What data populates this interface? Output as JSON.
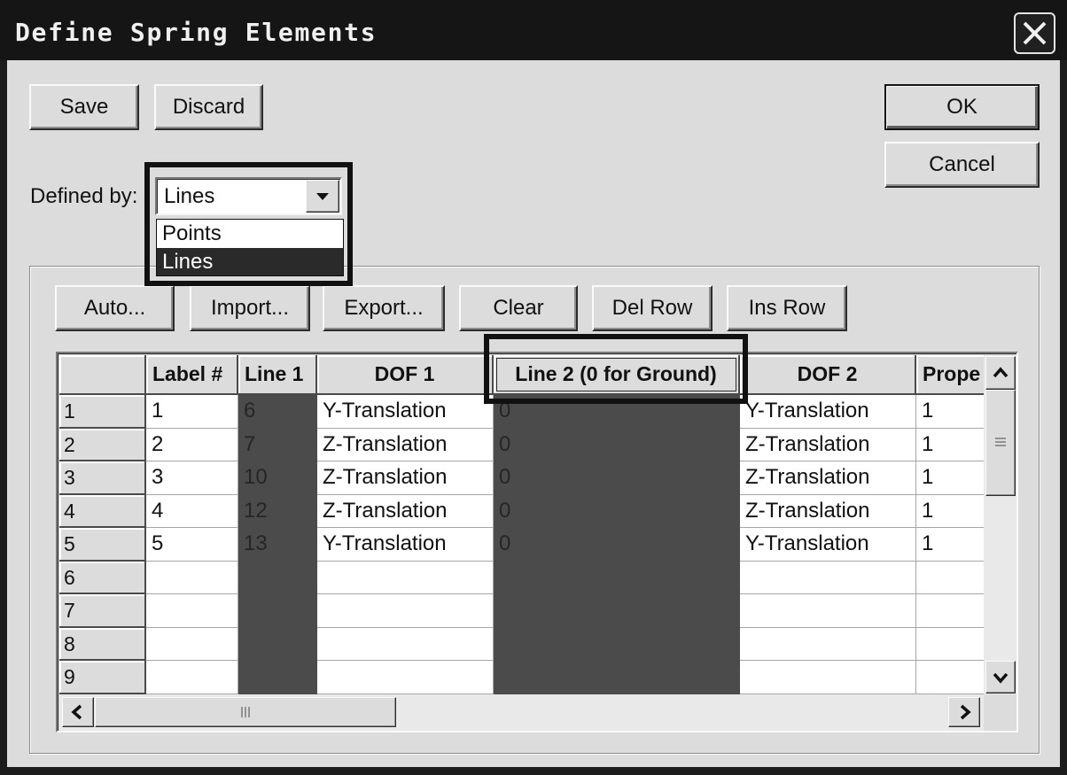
{
  "window": {
    "title": "Define Spring Elements"
  },
  "buttons": {
    "save": "Save",
    "discard": "Discard",
    "ok": "OK",
    "cancel": "Cancel"
  },
  "defined_by": {
    "label": "Defined by:",
    "value": "Lines",
    "expanded": true,
    "options": [
      "Points",
      "Lines"
    ],
    "highlighted_index": 1
  },
  "grid_buttons": {
    "auto": "Auto...",
    "import": "Import...",
    "export": "Export...",
    "clear": "Clear",
    "del_row": "Del Row",
    "ins_row": "Ins Row"
  },
  "table": {
    "columns": [
      "Label #",
      "Line 1",
      "DOF 1",
      "Line 2 (0 for Ground)",
      "DOF 2",
      "Prope"
    ],
    "rows": [
      {
        "num": "1",
        "cells": [
          "1",
          "6",
          "Y-Translation",
          "0",
          "Y-Translation",
          "1"
        ]
      },
      {
        "num": "2",
        "cells": [
          "2",
          "7",
          "Z-Translation",
          "0",
          "Z-Translation",
          "1"
        ]
      },
      {
        "num": "3",
        "cells": [
          "3",
          "10",
          "Z-Translation",
          "0",
          "Z-Translation",
          "1"
        ]
      },
      {
        "num": "4",
        "cells": [
          "4",
          "12",
          "Z-Translation",
          "0",
          "Z-Translation",
          "1"
        ]
      },
      {
        "num": "5",
        "cells": [
          "5",
          "13",
          "Y-Translation",
          "0",
          "Y-Translation",
          "1"
        ]
      },
      {
        "num": "6",
        "cells": [
          "",
          "",
          "",
          "",
          "",
          ""
        ]
      },
      {
        "num": "7",
        "cells": [
          "",
          "",
          "",
          "",
          "",
          ""
        ]
      },
      {
        "num": "8",
        "cells": [
          "",
          "",
          "",
          "",
          "",
          ""
        ]
      },
      {
        "num": "9",
        "cells": [
          "",
          "",
          "",
          "",
          "",
          ""
        ]
      }
    ]
  },
  "icons": {
    "close": "close-icon",
    "dropdown": "chevron-down-icon",
    "scroll_up": "chevron-up-icon",
    "scroll_down": "chevron-down-icon",
    "scroll_left": "chevron-left-icon",
    "scroll_right": "chevron-right-icon",
    "thumb_grip": "grip-icon"
  },
  "colors": {
    "title_bar": "#151515",
    "dialog_face": "#dcdcdc",
    "shaded_column": "#4b4b4b",
    "selected_option": "#2a2a2a",
    "callout_frame": "#111111"
  }
}
